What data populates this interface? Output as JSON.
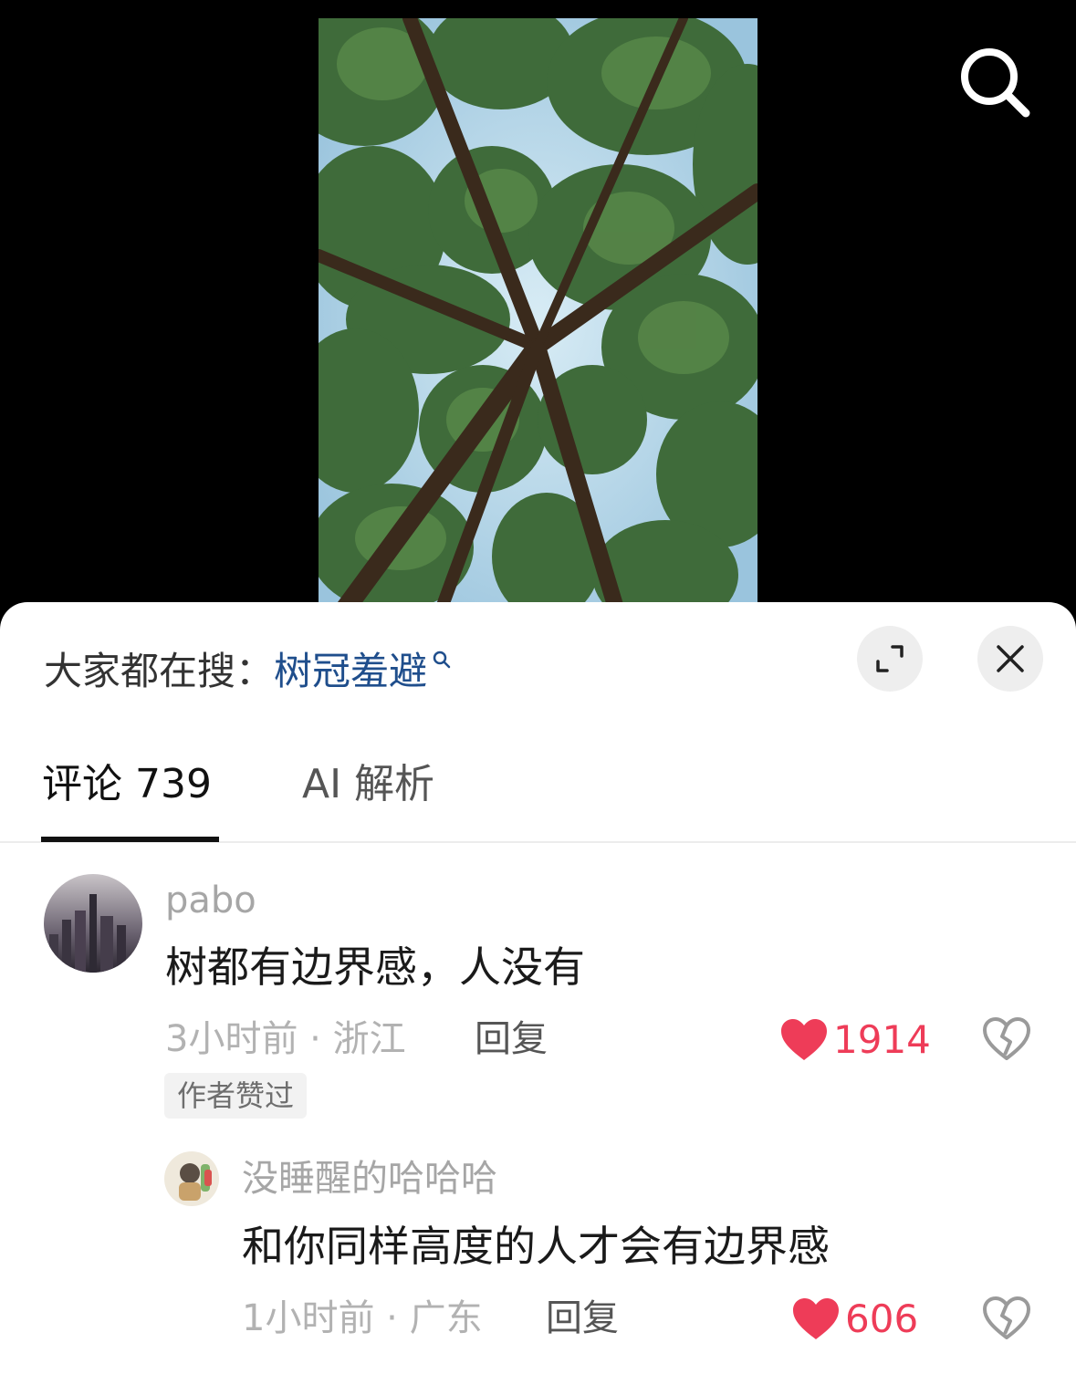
{
  "icons": {
    "search": "search-icon",
    "expand": "expand-icon",
    "close": "close-icon",
    "like": "heart-icon",
    "dislike": "broken-heart-icon",
    "trend_search": "search-icon"
  },
  "colors": {
    "accent_like": "#ee3c58",
    "trend_keyword": "#1f4e8c"
  },
  "trending": {
    "prefix": "大家都在搜：",
    "keyword": "树冠羞避"
  },
  "tabs": [
    {
      "label": "评论 739",
      "active": true
    },
    {
      "label": "AI 解析",
      "active": false
    }
  ],
  "comments": [
    {
      "username": "pabo",
      "text": "树都有边界感，人没有",
      "meta": "3小时前 · 浙江",
      "reply_label": "回复",
      "likes": "1914",
      "badge": "作者赞过",
      "replies": [
        {
          "username": "没睡醒的哈哈哈",
          "text": "和你同样高度的人才会有边界感",
          "meta": "1小时前 · 广东",
          "reply_label": "回复",
          "likes": "606"
        }
      ]
    }
  ]
}
